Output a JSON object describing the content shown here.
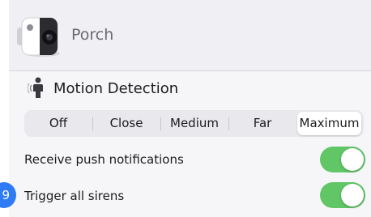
{
  "header": {
    "title": "Porch",
    "camera_icon": "security-camera-icon"
  },
  "motion": {
    "title": "Motion Detection",
    "icon": "motion-person-icon",
    "options": [
      "Off",
      "Close",
      "Medium",
      "Far",
      "Maximum"
    ],
    "selected": "Maximum"
  },
  "settings": {
    "push_label": "Receive push notifications",
    "push_on": true,
    "sirens_label": "Trigger all sirens",
    "sirens_on": true
  },
  "step_badge": "9",
  "colors": {
    "toggle_on": "#61c666",
    "badge": "#2f7bf6",
    "header_bg": "#efeff4"
  }
}
